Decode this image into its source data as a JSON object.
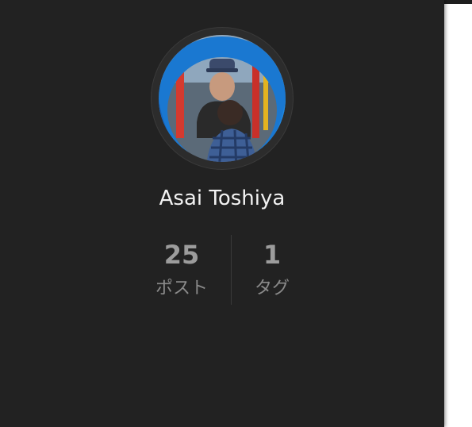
{
  "profile": {
    "name": "Asai Toshiya",
    "avatar_alt": "Asai Toshiya"
  },
  "stats": [
    {
      "value": "25",
      "label": "ポスト"
    },
    {
      "value": "1",
      "label": "タグ"
    }
  ],
  "colors": {
    "sidebar_bg": "#222222",
    "name_text": "#f2f2f2",
    "stat_value": "#9c9c9c",
    "stat_label": "#8a8a8a",
    "page_bg": "#ffffff"
  }
}
